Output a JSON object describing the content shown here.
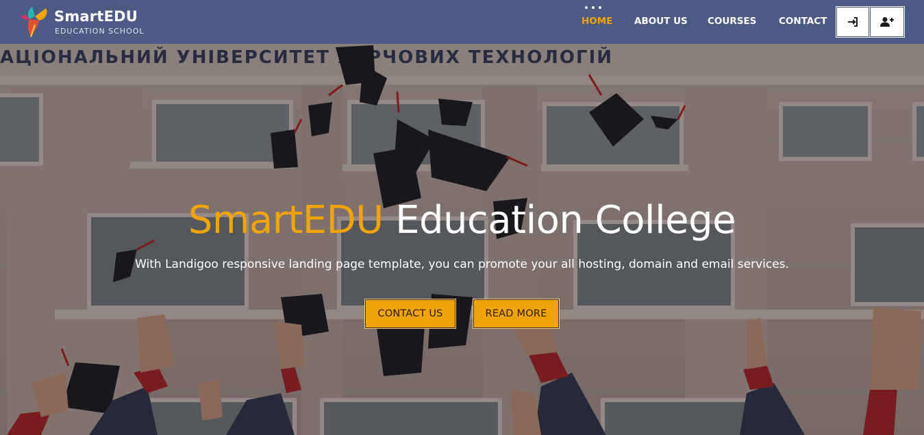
{
  "brand": {
    "title": "SmartEDU",
    "subtitle": "EDUCATION SCHOOL"
  },
  "nav": {
    "items": [
      {
        "label": "HOME",
        "active": true
      },
      {
        "label": "ABOUT US",
        "active": false
      },
      {
        "label": "COURSES",
        "active": false
      },
      {
        "label": "CONTACT",
        "active": false
      }
    ],
    "login_icon": "sign-in-icon",
    "register_icon": "user-plus-icon"
  },
  "hero": {
    "title_brand": "SmartEDU",
    "title_rest": "Education College",
    "subtitle": "With Landigoo responsive landing page template, you can promote your all hosting, domain and email services.",
    "buttons": {
      "contact": "CONTACT US",
      "read_more": "READ MORE"
    },
    "building_sign": "АЦІОНАЛЬНИЙ УНІВЕРСИТЕТ ХАРЧОВИХ ТЕХНОЛОГІЙ"
  },
  "colors": {
    "navbar": "#4b5b84",
    "accent": "#f0a30a",
    "text_light": "#ffffff"
  }
}
